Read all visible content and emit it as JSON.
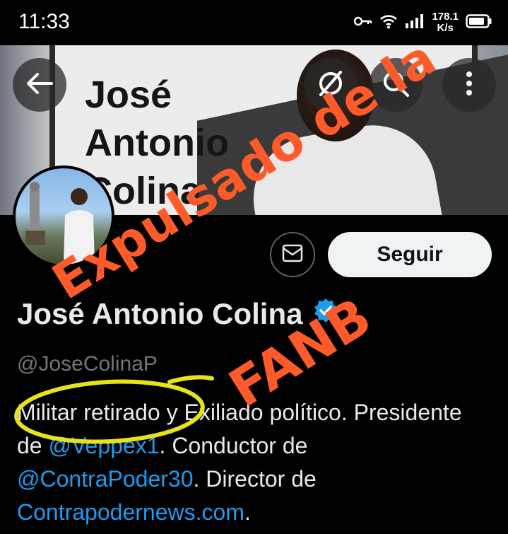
{
  "status_bar": {
    "time": "11:33",
    "speed_value": "178.1",
    "speed_unit": "K/s"
  },
  "banner": {
    "lines": [
      "José",
      "Antonio",
      "Colina"
    ]
  },
  "profile": {
    "follow_label": "Seguir",
    "name": "José Antonio Colina",
    "handle": "@JoseColinaP",
    "bio_parts": {
      "p1": "Militar retirado y Exiliado político. Presidente de ",
      "link1": "@Veppex1",
      "p2": ". Conductor de ",
      "link2": "@ContraPoder30",
      "p3": ". Director de ",
      "link3": "Contrapodernews.com",
      "p4": "."
    }
  },
  "annotation": {
    "stamp_line1": "Expulsado de la",
    "stamp_line2": "FANB"
  },
  "colors": {
    "accent": "#1d9bf0",
    "stamp": "#ff5a2a",
    "circle": "#e8e21a"
  },
  "icons": [
    "back-arrow-icon",
    "grok-icon",
    "search-icon",
    "more-icon",
    "message-icon",
    "verified-icon",
    "key-icon",
    "wifi-icon",
    "signal-icon",
    "battery-icon"
  ]
}
